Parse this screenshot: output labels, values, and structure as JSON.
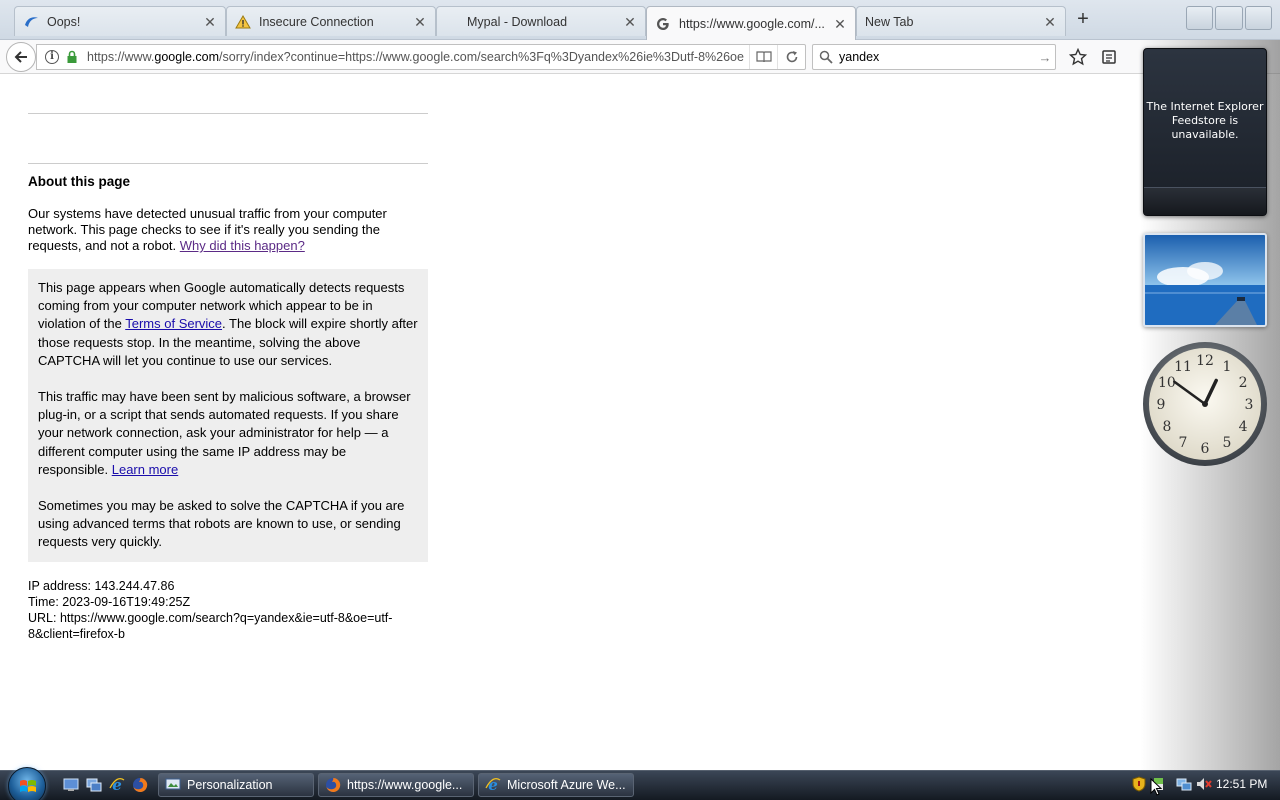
{
  "browser": {
    "tabs": [
      {
        "title": "Oops!",
        "icon": "palemoon-icon",
        "active": false
      },
      {
        "title": "Insecure Connection",
        "icon": "warning-icon",
        "active": false
      },
      {
        "title": "Mypal - Download",
        "icon": "none",
        "active": false
      },
      {
        "title": "https://www.google.com/...",
        "icon": "google-icon",
        "active": true
      },
      {
        "title": "New Tab",
        "icon": "none",
        "active": false
      }
    ],
    "url_prefix": "https://www.",
    "url_domain": "google.com",
    "url_rest": "/sorry/index?continue=https://www.google.com/search%3Fq%3Dyandex%26ie%3Dutf-8%26oe",
    "search_value": "yandex"
  },
  "page": {
    "about_title": "About this page",
    "about_text": "Our systems have detected unusual traffic from your computer network. This page checks to see if it's really you sending the requests, and not a robot.",
    "why_link": "Why did this happen?",
    "box_p1_before": "This page appears when Google automatically detects requests coming from your computer network which appear to be in violation of the",
    "terms_link": "Terms of Service",
    "box_p1_after": ". The block will expire shortly after those requests stop. In the meantime, solving the above CAPTCHA will let you continue to use our services.",
    "box_p2": "This traffic may have been sent by malicious software, a browser plug-in, or a script that sends automated requests. If you share your network connection, ask your administrator for help — a different computer using the same IP address may be responsible.",
    "learn_more": "Learn more",
    "box_p3": "Sometimes you may be asked to solve the CAPTCHA if you are using advanced terms that robots are known to use, or sending requests very quickly.",
    "ip_line": "IP address: 143.244.47.86",
    "time_line": "Time: 2023-09-16T19:49:25Z",
    "url_line": "URL: https://www.google.com/search?q=yandex&ie=utf-8&oe=utf-8&client=firefox-b"
  },
  "gadgets": {
    "feed_message": "The Internet Explorer Feedstore is unavailable.",
    "clock_hour": 12,
    "clock_minute": 51
  },
  "taskbar": {
    "buttons": [
      {
        "label": "Personalization",
        "icon": "personalization-icon"
      },
      {
        "label": "https://www.google...",
        "icon": "firefox-icon"
      },
      {
        "label": "Microsoft Azure We...",
        "icon": "ie-icon"
      }
    ],
    "clock": "12:51 PM"
  }
}
